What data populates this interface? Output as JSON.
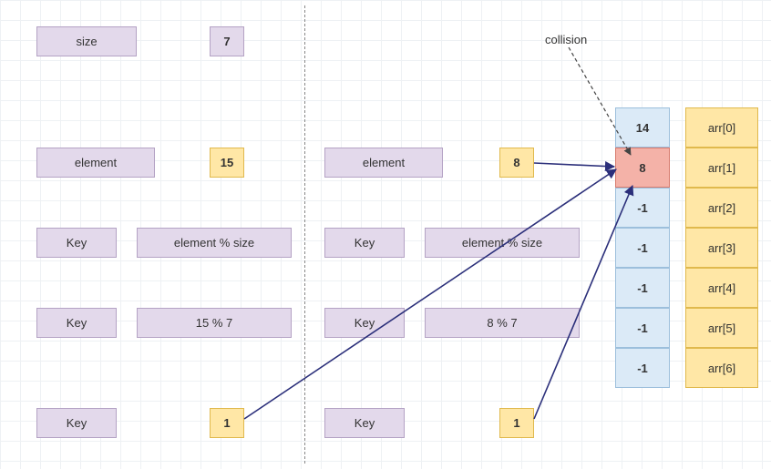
{
  "top": {
    "size_label": "size",
    "size_value": "7",
    "collision": "collision"
  },
  "left": {
    "element_label": "element",
    "element_value": "15",
    "key1_label": "Key",
    "key1_formula": "element % size",
    "key2_label": "Key",
    "key2_formula": "15 % 7",
    "key3_label": "Key",
    "key3_value": "1"
  },
  "right": {
    "element_label": "element",
    "element_value": "8",
    "key1_label": "Key",
    "key1_formula": "element % size",
    "key2_label": "Key",
    "key2_formula": "8 % 7",
    "key3_label": "Key",
    "key3_value": "1"
  },
  "array": {
    "cells": [
      {
        "value": "14",
        "label": "arr[0]",
        "style": "blue"
      },
      {
        "value": "8",
        "label": "arr[1]",
        "style": "red"
      },
      {
        "value": "-1",
        "label": "arr[2]",
        "style": "blue"
      },
      {
        "value": "-1",
        "label": "arr[3]",
        "style": "blue"
      },
      {
        "value": "-1",
        "label": "arr[4]",
        "style": "blue"
      },
      {
        "value": "-1",
        "label": "arr[5]",
        "style": "blue"
      },
      {
        "value": "-1",
        "label": "arr[6]",
        "style": "blue"
      }
    ]
  },
  "chart_data": {
    "type": "table",
    "title": "Hash collision illustration: element % size",
    "size": 7,
    "elements_inserted": [
      15,
      8
    ],
    "hash_function": "element % size",
    "computed_keys": {
      "15": 1,
      "8": 1
    },
    "collision_index": 1,
    "array_state": [
      14,
      8,
      -1,
      -1,
      -1,
      -1,
      -1
    ],
    "array_labels": [
      "arr[0]",
      "arr[1]",
      "arr[2]",
      "arr[3]",
      "arr[4]",
      "arr[5]",
      "arr[6]"
    ]
  }
}
